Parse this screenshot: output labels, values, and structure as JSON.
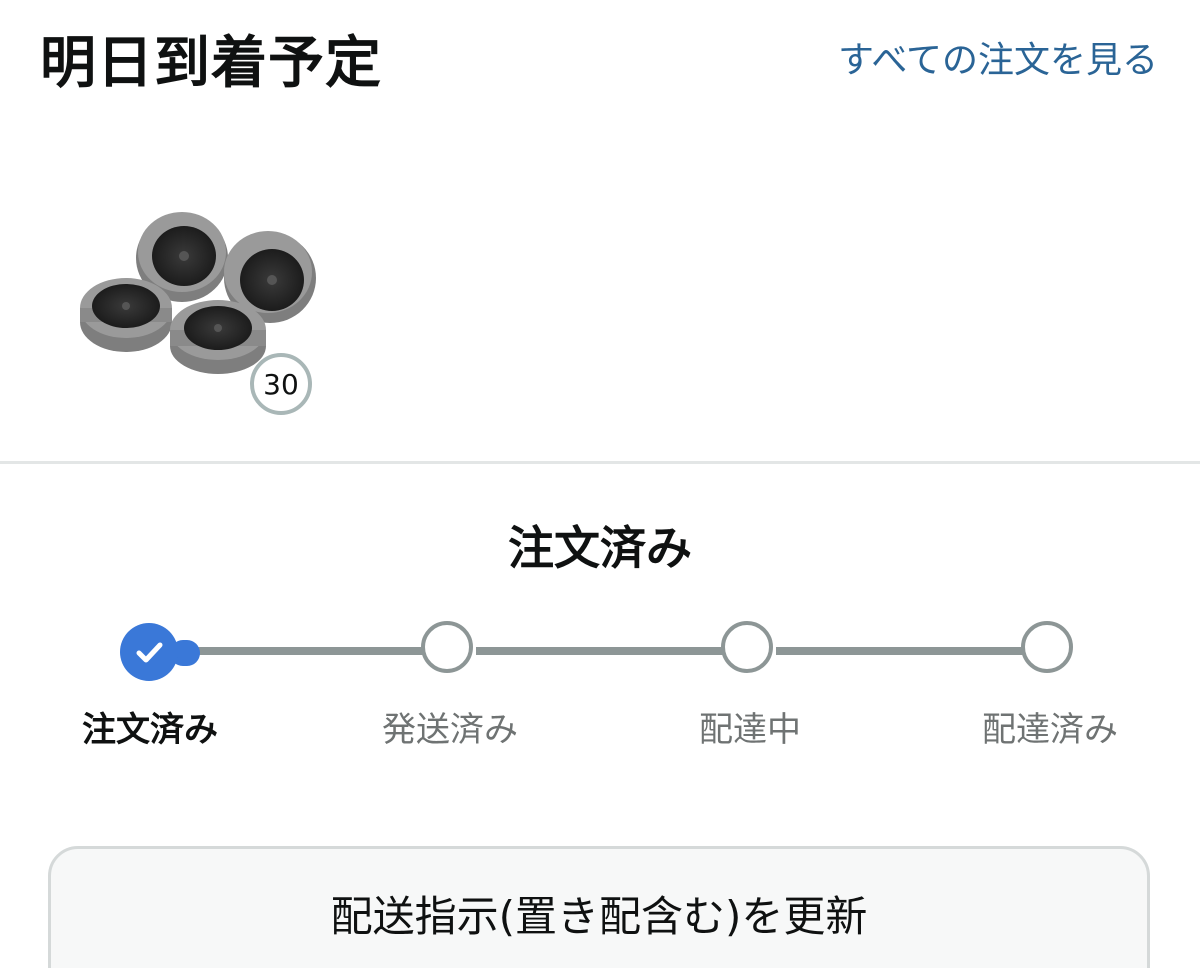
{
  "header": {
    "title": "明日到着予定",
    "view_all_link": "すべての注文を見る"
  },
  "product": {
    "image_icon": "wheels-product-image",
    "quantity": "30"
  },
  "status": {
    "heading": "注文済み",
    "current_step": 0,
    "steps": [
      {
        "label": "注文済み"
      },
      {
        "label": "発送済み"
      },
      {
        "label": "配達中"
      },
      {
        "label": "配達済み"
      }
    ]
  },
  "actions": {
    "update_delivery_label": "配送指示(置き配含む)を更新"
  },
  "colors": {
    "accent": "#3a78d8",
    "link": "#2a6496",
    "track": "#8d9696"
  }
}
